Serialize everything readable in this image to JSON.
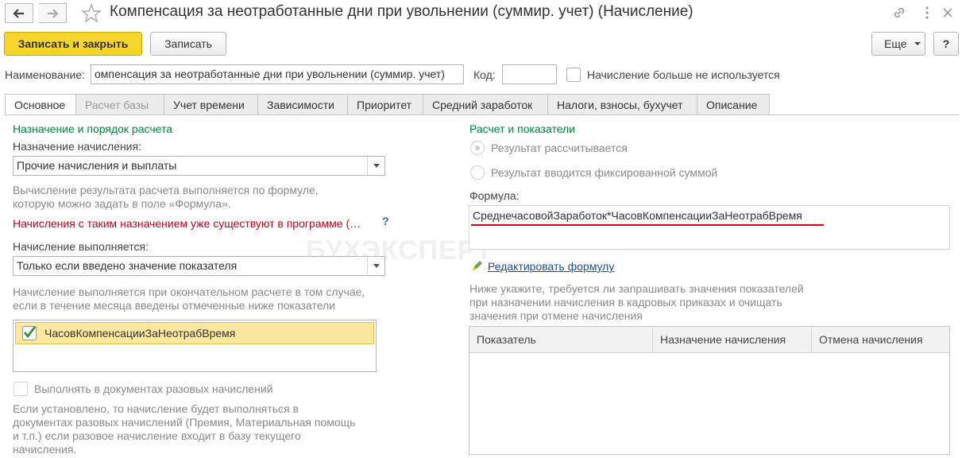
{
  "window": {
    "title": "Компенсация за неотработанные дни при увольнении (суммир. учет) (Начисление)"
  },
  "toolbar": {
    "save_close_label": "Записать и закрыть",
    "save_label": "Записать",
    "more_label": "Еще",
    "help_label": "?"
  },
  "fields": {
    "name_label": "Наименование:",
    "name_value": "омпенсация за неотработанные дни при увольнении (суммир. учет)",
    "code_label": "Код:",
    "code_value": "",
    "unused_label": "Начисление больше не используется"
  },
  "tabs": [
    {
      "label": "Основное"
    },
    {
      "label": "Расчет базы"
    },
    {
      "label": "Учет времени"
    },
    {
      "label": "Зависимости"
    },
    {
      "label": "Приоритет"
    },
    {
      "label": "Средний заработок"
    },
    {
      "label": "Налоги, взносы, бухучет"
    },
    {
      "label": "Описание"
    }
  ],
  "left": {
    "section_title": "Назначение и порядок расчета",
    "purpose_label": "Назначение начисления:",
    "purpose_value": "Прочие начисления и выплаты",
    "formula_hint_1": "Вычисление результата расчета выполняется по формуле,",
    "formula_hint_2": "которую можно задать в поле «Формула».",
    "warning": "Начисления с таким назначением уже существуют в программе (…",
    "warning_help": "?",
    "executes_label": "Начисление выполняется:",
    "executes_value": "Только если введено значение показателя",
    "exec_hint_1": "Начисление выполняется при окончательном расчете в том случае,",
    "exec_hint_2": "если в течение месяца введены отмеченные ниже показатели",
    "indicator_item": "ЧасовКомпенсацииЗаНеотрабВремя",
    "onetime_label": "Выполнять в документах разовых начислений",
    "onetime_hint_1": "Если установлено, то начисление будет выполняться в",
    "onetime_hint_2": "документах разовых начислений (Премия, Материальная помощь",
    "onetime_hint_3": "и т.п.) если разовое начисление входит в базу текущего",
    "onetime_hint_4": "начисления."
  },
  "right": {
    "section_title": "Расчет и показатели",
    "radio_calc": "Результат рассчитывается",
    "radio_fixed": "Результат вводится фиксированной суммой",
    "formula_label": "Формула:",
    "formula_value": "СреднечасовойЗаработок*ЧасовКомпенсацииЗаНеотрабВремя",
    "edit_formula_link": "Редактировать формулу",
    "request_hint_1": "Ниже укажите, требуется ли запрашивать значения показателей",
    "request_hint_2": "при назначении начисления в кадровых приказах и очищать",
    "request_hint_3": "значения при отмене начисления",
    "columns": [
      "Показатель",
      "Назначение начисления",
      "Отмена начисления"
    ]
  },
  "watermark": "БУХЭКСПЕРТ",
  "colors": {
    "accent_yellow": "#f6d62d",
    "section_green": "#00873d",
    "warning_red": "#c8001a",
    "link_blue": "#1a4fa0",
    "underline_red": "#d4001a"
  }
}
